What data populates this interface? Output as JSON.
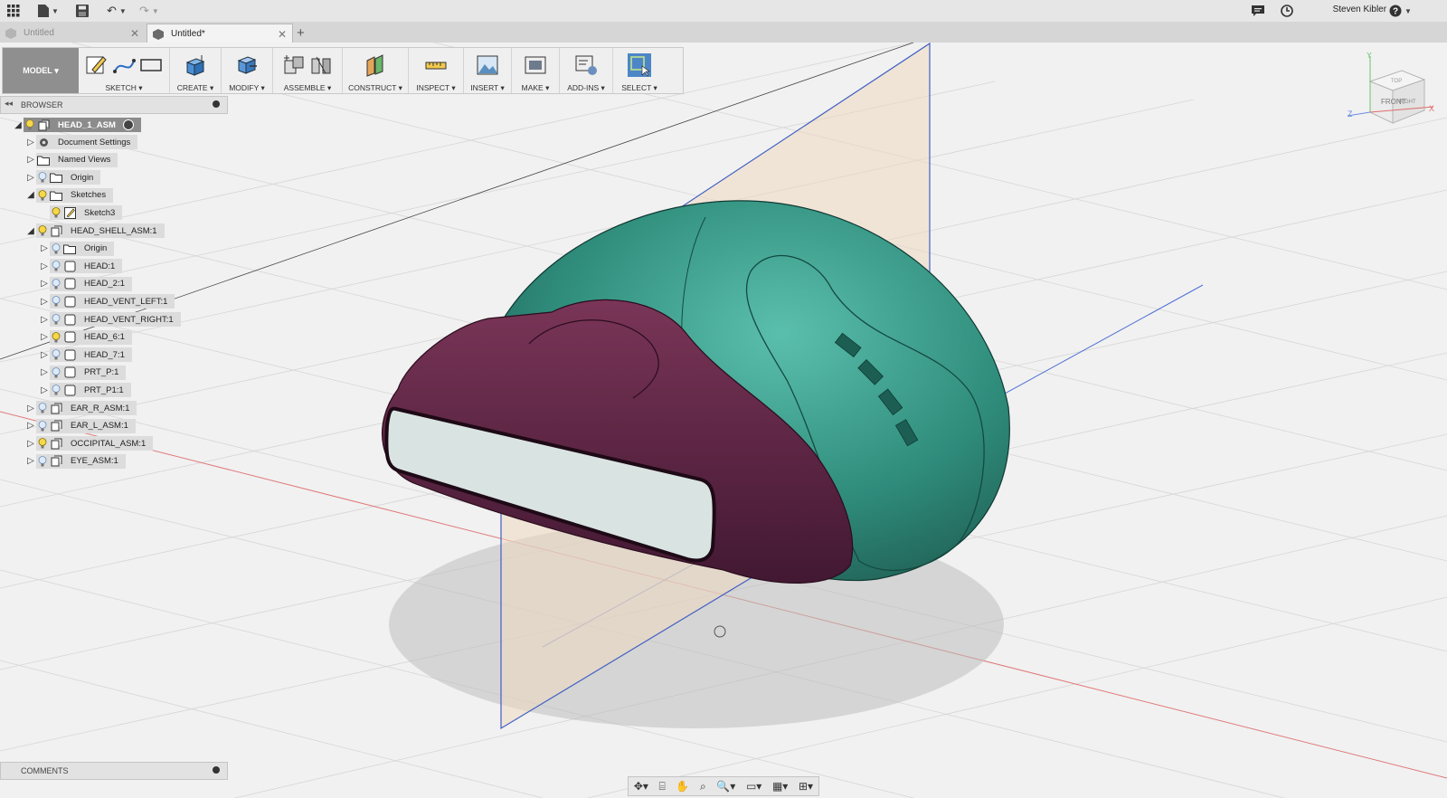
{
  "app": {
    "user_name": "Steven Kibler",
    "help_label": "?"
  },
  "tabs": [
    {
      "label": "Untitled",
      "active": false
    },
    {
      "label": "Untitled*",
      "active": true
    }
  ],
  "toolbar": {
    "workspace": "MODEL",
    "groups": [
      {
        "label": "SKETCH"
      },
      {
        "label": "CREATE"
      },
      {
        "label": "MODIFY"
      },
      {
        "label": "ASSEMBLE"
      },
      {
        "label": "CONSTRUCT"
      },
      {
        "label": "INSPECT"
      },
      {
        "label": "INSERT"
      },
      {
        "label": "MAKE"
      },
      {
        "label": "ADD-INS"
      },
      {
        "label": "SELECT"
      }
    ]
  },
  "browser": {
    "title": "BROWSER",
    "root": "HEAD_1_ASM",
    "items": [
      {
        "label": "Document Settings"
      },
      {
        "label": "Named Views"
      },
      {
        "label": "Origin"
      },
      {
        "label": "Sketches"
      },
      {
        "label": "Sketch3"
      },
      {
        "label": "HEAD_SHELL_ASM:1"
      },
      {
        "label": "Origin"
      },
      {
        "label": "HEAD:1"
      },
      {
        "label": "HEAD_2:1"
      },
      {
        "label": "HEAD_VENT_LEFT:1"
      },
      {
        "label": "HEAD_VENT_RIGHT:1"
      },
      {
        "label": "HEAD_6:1"
      },
      {
        "label": "HEAD_7:1"
      },
      {
        "label": "PRT_P:1"
      },
      {
        "label": "PRT_P1:1"
      },
      {
        "label": "EAR_R_ASM:1"
      },
      {
        "label": "EAR_L_ASM:1"
      },
      {
        "label": "OCCIPITAL_ASM:1"
      },
      {
        "label": "EYE_ASM:1"
      }
    ]
  },
  "comments": {
    "title": "COMMENTS"
  },
  "viewcube": {
    "face_front": "FRONT",
    "face_right": "RIGHT",
    "face_top": "TOP",
    "axis_x": "X",
    "axis_y": "Y",
    "axis_z": "Z"
  },
  "colors": {
    "shell_teal": "#2e8a7a",
    "visor_purple": "#5a2440",
    "plane_fill": "#efd9bf",
    "plane_edge": "#3f5fc4",
    "toolbar_model": "#8f8f8f"
  }
}
